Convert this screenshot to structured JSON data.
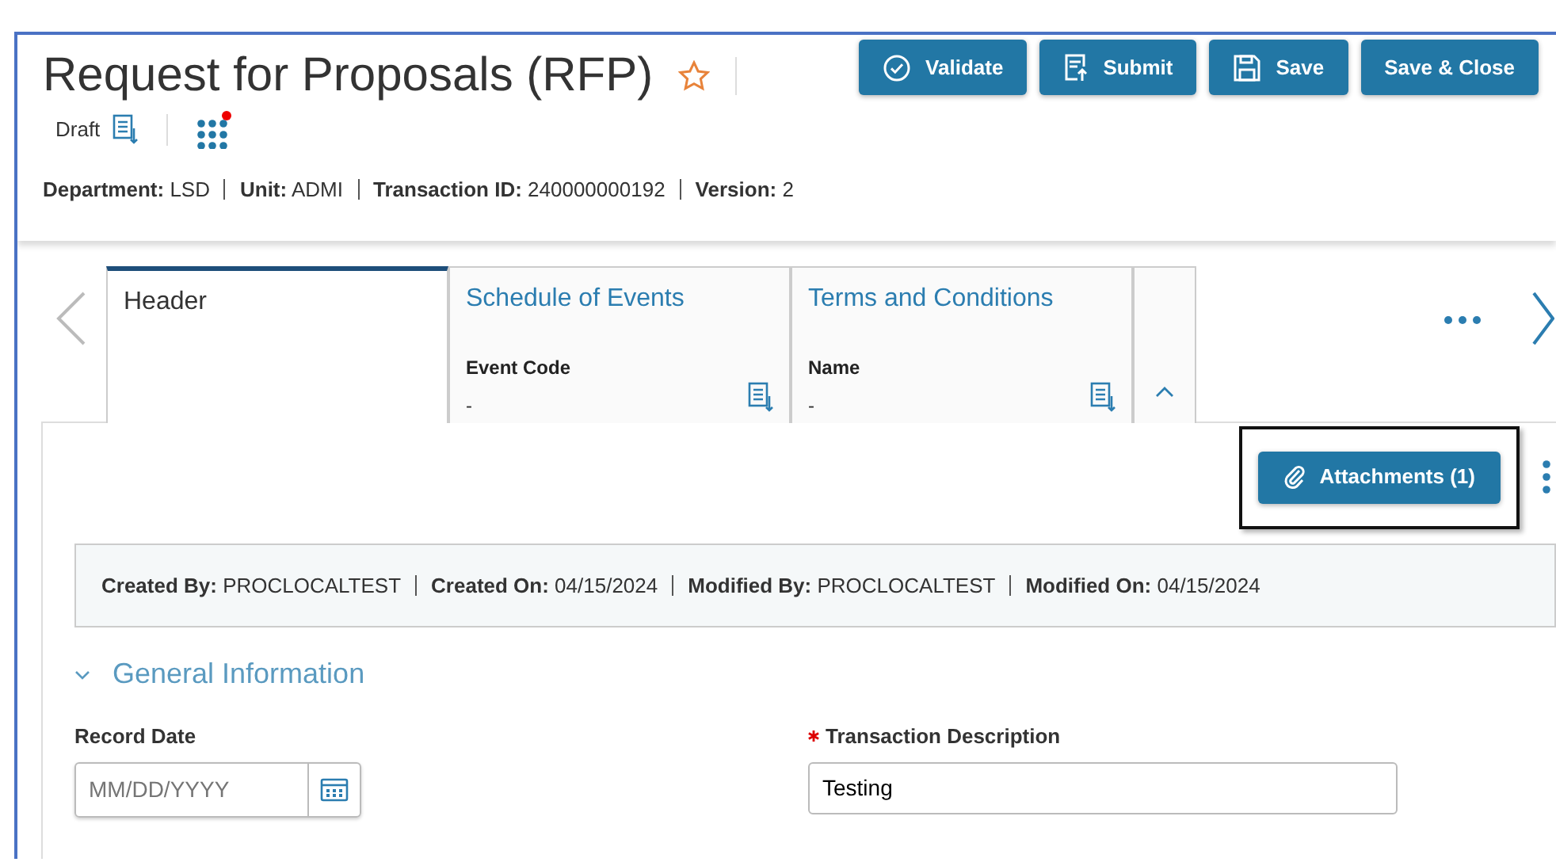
{
  "title": "Request for Proposals (RFP)",
  "favorite": false,
  "status": "Draft",
  "notification": true,
  "buttons": [
    {
      "label": "Validate",
      "kind": "validate"
    },
    {
      "label": "Submit",
      "kind": "submit"
    },
    {
      "label": "Save",
      "kind": "save"
    },
    {
      "label": "Save & Close",
      "kind": "plain"
    }
  ],
  "meta": [
    {
      "label": "Department:",
      "value": "LSD"
    },
    {
      "label": "Unit:",
      "value": "ADMI"
    },
    {
      "label": "Transaction ID:",
      "value": "240000000192"
    },
    {
      "label": "Version:",
      "value": "2"
    }
  ],
  "tabs": [
    {
      "label": "Header",
      "selected": true
    },
    {
      "label": "Schedule of Events",
      "selected": false,
      "field": "Event Code",
      "value": "-"
    },
    {
      "label": "Terms and Conditions",
      "selected": false,
      "field": "Name",
      "value": "-"
    }
  ],
  "tabs_expanded": true,
  "attachments_button": "Attachments (1)",
  "audit": [
    {
      "label": "Created By:",
      "value": "PROCLOCALTEST"
    },
    {
      "label": "Created On:",
      "value": "04/15/2024"
    },
    {
      "label": "Modified By:",
      "value": "PROCLOCALTEST"
    },
    {
      "label": "Modified On:",
      "value": "04/15/2024"
    }
  ],
  "section": {
    "title": "General Information",
    "expanded": true
  },
  "fields": [
    {
      "label": "Record Date",
      "kind": "date",
      "placeholder": "MM/DD/YYYY",
      "required": false
    },
    {
      "label": "Transaction Description",
      "kind": "text",
      "value": "Testing",
      "required": true
    }
  ]
}
